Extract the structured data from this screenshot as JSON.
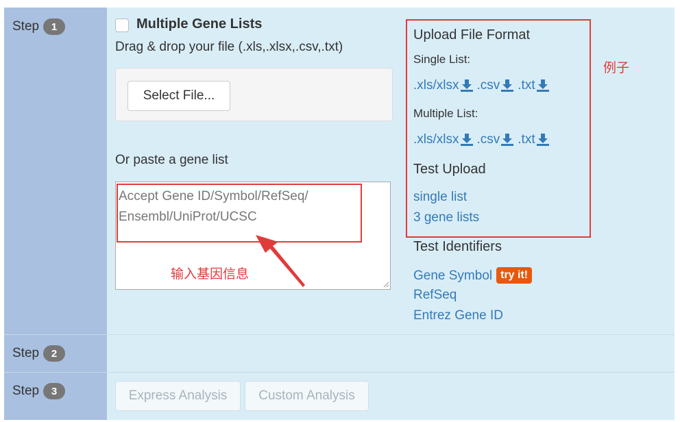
{
  "steps": [
    {
      "label": "Step",
      "number": "1"
    },
    {
      "label": "Step",
      "number": "2"
    },
    {
      "label": "Step",
      "number": "3"
    }
  ],
  "upload": {
    "title": "Multiple Gene Lists",
    "drag_text": "Drag & drop your file (.xls,.xlsx,.csv,.txt)",
    "select_button": "Select File..."
  },
  "paste": {
    "label": "Or paste a gene list",
    "placeholder": "Accept Gene ID/Symbol/RefSeq/\nEnsembl/UniProt/UCSC"
  },
  "format": {
    "title": "Upload File Format",
    "single_label": "Single List:",
    "multiple_label": "Multiple List:",
    "single_links": [
      ".xls/xlsx",
      ".csv",
      ".txt"
    ],
    "multiple_links": [
      ".xls/xlsx",
      ".csv",
      ".txt"
    ]
  },
  "test_upload": {
    "title": "Test Upload",
    "links": [
      "single list",
      "3 gene lists"
    ]
  },
  "test_identifiers": {
    "title": "Test Identifiers",
    "links": [
      "Gene Symbol",
      "RefSeq",
      "Entrez Gene ID"
    ],
    "try_badge": "try it!"
  },
  "annotations": {
    "example": "例子",
    "input_gene": "输入基因信息"
  },
  "actions": {
    "express": "Express Analysis",
    "custom": "Custom Analysis"
  },
  "colors": {
    "panel_bg": "#d9edf7",
    "step_bg": "#a9c0e0",
    "link": "#337ab7",
    "annotation_red": "#e03b3b",
    "try_badge": "#e8590c"
  },
  "icons": {
    "download": "download-icon"
  }
}
